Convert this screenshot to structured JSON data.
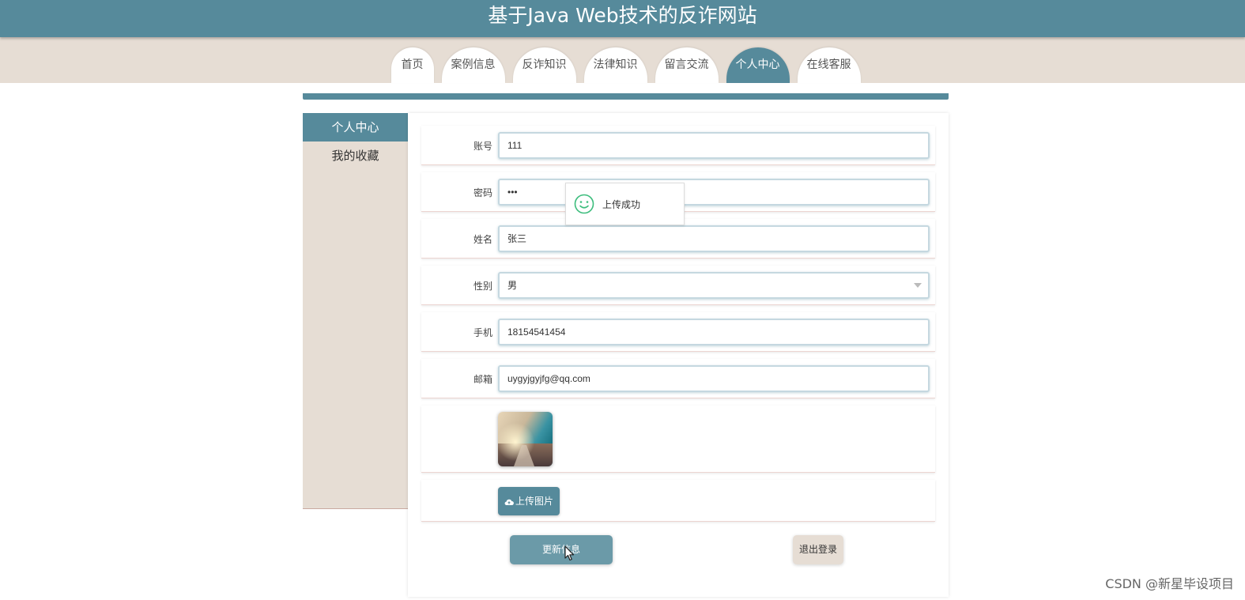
{
  "header": {
    "title": "基于Java Web技术的反诈网站"
  },
  "nav": {
    "tabs": [
      {
        "label": "首页",
        "active": false
      },
      {
        "label": "案例信息",
        "active": false
      },
      {
        "label": "反诈知识",
        "active": false
      },
      {
        "label": "法律知识",
        "active": false
      },
      {
        "label": "留言交流",
        "active": false
      },
      {
        "label": "个人中心",
        "active": true
      },
      {
        "label": "在线客服",
        "active": false
      }
    ]
  },
  "sidebar": {
    "items": [
      {
        "label": "个人中心",
        "active": true
      },
      {
        "label": "我的收藏",
        "active": false
      }
    ]
  },
  "form": {
    "account": {
      "label": "账号",
      "value": "111"
    },
    "password": {
      "label": "密码",
      "value": "•••"
    },
    "name": {
      "label": "姓名",
      "value": "张三"
    },
    "gender": {
      "label": "性别",
      "value": "男"
    },
    "phone": {
      "label": "手机",
      "value": "18154541454"
    },
    "email": {
      "label": "邮箱",
      "value": "uygyjgyjfg@qq.com"
    },
    "upload_label": "上传图片",
    "update_label": "更新信息",
    "logout_label": "退出登录"
  },
  "toast": {
    "text": "上传成功",
    "icon": "smile-icon"
  },
  "watermark": "CSDN @新星毕设项目",
  "colors": {
    "primary": "#568a9b",
    "beige": "#e6ddd4",
    "success": "#3dbd7d"
  }
}
